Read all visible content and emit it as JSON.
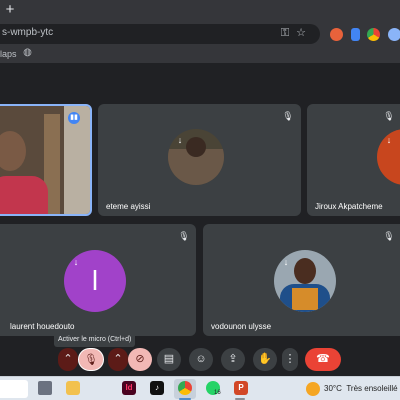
{
  "browser": {
    "new_tab_icon": "plus-icon",
    "url": "s-wmpb-ytc",
    "bookmark_label": "laps",
    "bookmark_icon": "globe-icon",
    "omnibox_icons": [
      "key-icon",
      "star-icon"
    ],
    "extension_icons": [
      "extension-icon-1",
      "download-icon",
      "extension-icon-3",
      "profile-icon"
    ]
  },
  "meet": {
    "participants": [
      {
        "id": "self",
        "name": "",
        "speaking": true
      },
      {
        "id": "eteme",
        "name": "eteme ayissi",
        "muted": true
      },
      {
        "id": "jiroux",
        "name": "Jiroux Akpatcheme",
        "muted": true
      },
      {
        "id": "laurent",
        "name": "laurent houedouto",
        "initial": "l",
        "avatar_color": "#a142c9",
        "muted": true
      },
      {
        "id": "vodounon",
        "name": "vodounon ulysse",
        "muted": true
      }
    ],
    "tooltip": "Activer le micro (Ctrl+d)",
    "controls": [
      {
        "id": "mic-options",
        "icon": "chevron-up-icon"
      },
      {
        "id": "mic",
        "icon": "mic-off-icon",
        "state": "off"
      },
      {
        "id": "cam-options",
        "icon": "chevron-up-icon"
      },
      {
        "id": "camera",
        "icon": "camera-off-icon",
        "state": "off"
      },
      {
        "id": "captions",
        "icon": "captions-icon"
      },
      {
        "id": "reactions",
        "icon": "emoji-icon"
      },
      {
        "id": "present",
        "icon": "present-screen-icon"
      },
      {
        "id": "raise-hand",
        "icon": "hand-icon"
      },
      {
        "id": "more",
        "icon": "more-vert-icon"
      },
      {
        "id": "leave",
        "icon": "end-call-icon"
      }
    ]
  },
  "taskbar": {
    "items": [
      {
        "id": "task-view",
        "icon": "task-view-icon"
      },
      {
        "id": "explorer",
        "icon": "folder-icon"
      },
      {
        "id": "indesign",
        "icon": "indesign-icon",
        "label": "Id"
      },
      {
        "id": "tiktok",
        "icon": "tiktok-icon"
      },
      {
        "id": "chrome",
        "icon": "chrome-icon",
        "active": true
      },
      {
        "id": "whatsapp",
        "icon": "whatsapp-icon",
        "badge": "16"
      },
      {
        "id": "powerpoint",
        "icon": "powerpoint-icon",
        "label": "P"
      }
    ],
    "weather": {
      "temp": "30°C",
      "condition": "Très ensoleillé",
      "icon": "sun-icon"
    }
  }
}
